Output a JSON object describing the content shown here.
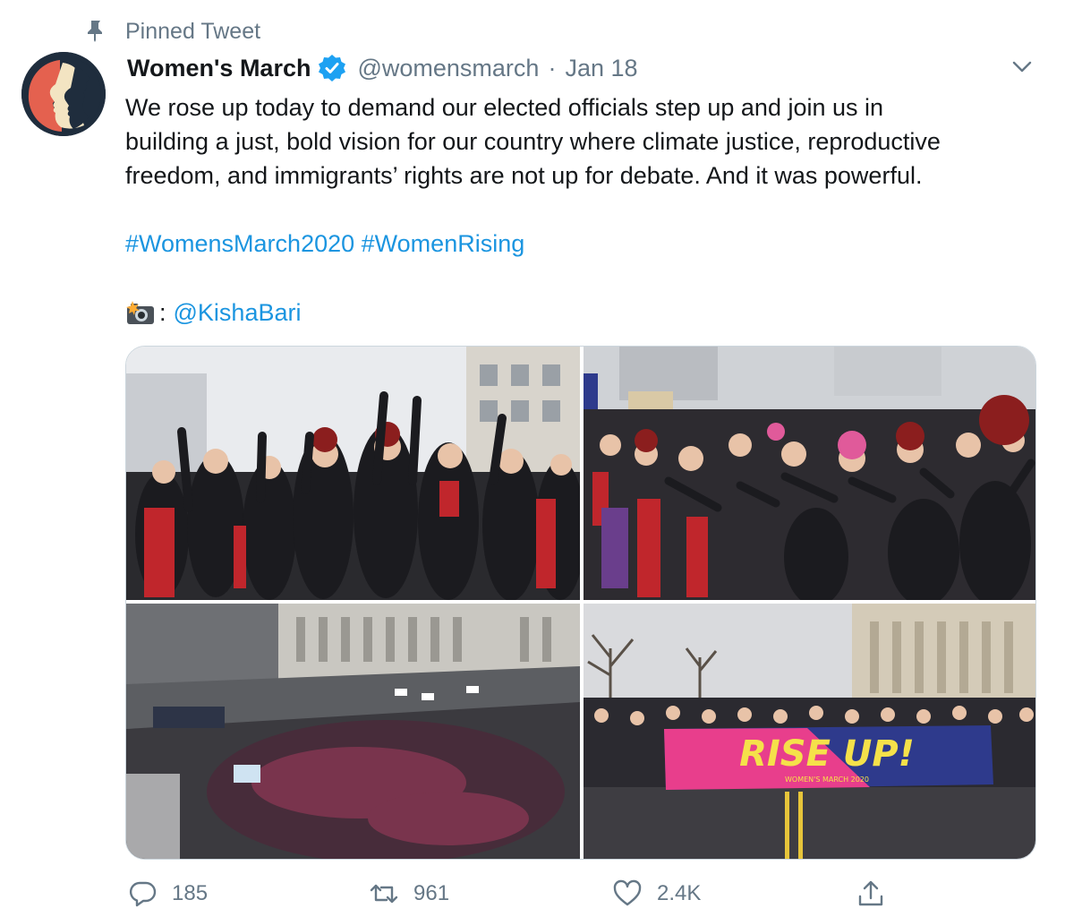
{
  "pinned": {
    "label": "Pinned Tweet",
    "icon": "pin-icon"
  },
  "author": {
    "name": "Women's March",
    "handle": "@womensmarch",
    "separator": "·",
    "date": "Jan 18",
    "verified": true
  },
  "tweet": {
    "lines": [
      "We rose up today to demand our elected officials step up and join us in",
      "building a just, bold vision for our country where climate justice, reproductive",
      "freedom, and immigrants’ rights are not up for debate. And it was powerful."
    ],
    "hashtags": [
      "#WomensMarch2020",
      "#WomenRising"
    ],
    "credit_separator": ":",
    "credit_mention": "@KishaBari"
  },
  "media": {
    "banner_text": "RISE UP!",
    "banner_subtext": "WOMEN'S MARCH 2020"
  },
  "actions": {
    "reply_count": "185",
    "retweet_count": "961",
    "like_count": "2.4K"
  },
  "colors": {
    "link": "#1b95e0",
    "secondary_text": "#657786",
    "verified": "#1da1f2",
    "banner_bg": "#2e3a8c",
    "banner_pink": "#e83e8c",
    "banner_text": "#f5e14a"
  }
}
